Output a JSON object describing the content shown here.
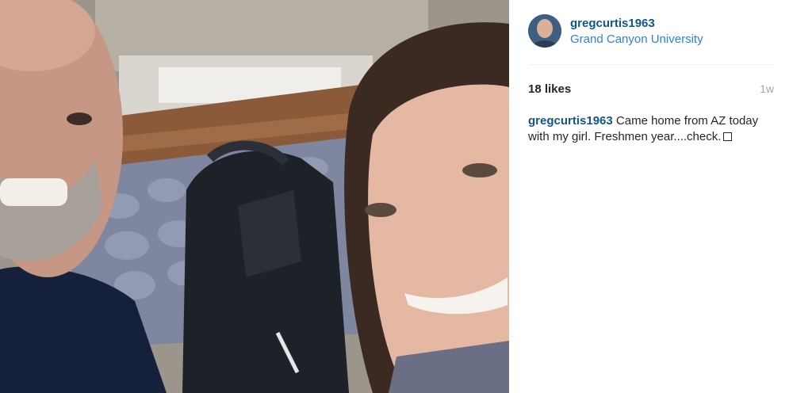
{
  "post": {
    "username": "gregcurtis1963",
    "location": "Grand Canyon University",
    "likes": "18 likes",
    "time": "1w",
    "caption": {
      "username": "gregcurtis1963",
      "text": "Came home from AZ today with my girl. Freshmen year....check.",
      "trailing_glyph": "box-glyph-icon"
    }
  },
  "colors": {
    "username": "#125688",
    "location": "#2b82d4",
    "text": "#262626",
    "muted": "#a5a7aa",
    "divider": "#efefef"
  }
}
